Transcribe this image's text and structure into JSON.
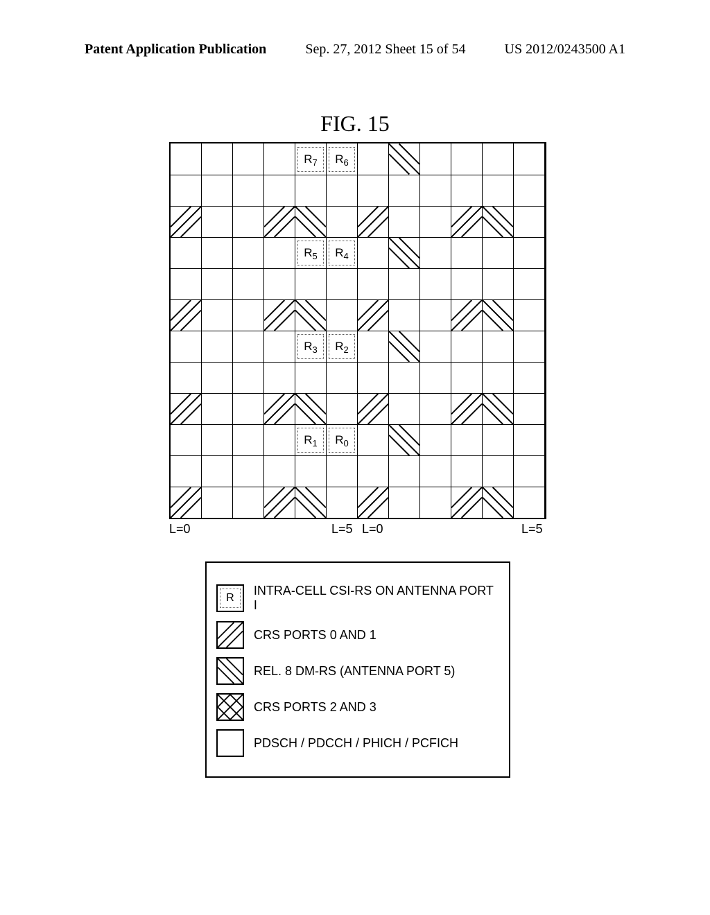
{
  "header": {
    "left": "Patent Application Publication",
    "center": "Sep. 27, 2012  Sheet 15 of 54",
    "right": "US 2012/0243500 A1"
  },
  "figure_title": "FIG. 15",
  "chart_data": {
    "type": "table",
    "rows": 12,
    "cols": 12,
    "xlabel_left_slot": "L=0",
    "xlabel_mid_left": "L=5",
    "xlabel_mid_right": "L=0",
    "xlabel_right_slot": "L=5",
    "r_cells": [
      {
        "row": 0,
        "col": 4,
        "label_prefix": "R",
        "label_sub": "7"
      },
      {
        "row": 0,
        "col": 5,
        "label_prefix": "R",
        "label_sub": "6"
      },
      {
        "row": 3,
        "col": 4,
        "label_prefix": "R",
        "label_sub": "5"
      },
      {
        "row": 3,
        "col": 5,
        "label_prefix": "R",
        "label_sub": "4"
      },
      {
        "row": 6,
        "col": 4,
        "label_prefix": "R",
        "label_sub": "3"
      },
      {
        "row": 6,
        "col": 5,
        "label_prefix": "R",
        "label_sub": "2"
      },
      {
        "row": 9,
        "col": 4,
        "label_prefix": "R",
        "label_sub": "1"
      },
      {
        "row": 9,
        "col": 5,
        "label_prefix": "R",
        "label_sub": "0"
      }
    ],
    "diag_forward_cells": [
      [
        2,
        0
      ],
      [
        2,
        3
      ],
      [
        2,
        6
      ],
      [
        2,
        9
      ],
      [
        5,
        0
      ],
      [
        5,
        3
      ],
      [
        5,
        6
      ],
      [
        5,
        9
      ],
      [
        8,
        0
      ],
      [
        8,
        3
      ],
      [
        8,
        6
      ],
      [
        8,
        9
      ],
      [
        11,
        0
      ],
      [
        11,
        3
      ],
      [
        11,
        6
      ],
      [
        11,
        9
      ]
    ],
    "diag_back_cells": [
      [
        0,
        7
      ],
      [
        3,
        7
      ],
      [
        6,
        7
      ],
      [
        9,
        7
      ],
      [
        2,
        4
      ],
      [
        2,
        10
      ],
      [
        5,
        4
      ],
      [
        5,
        10
      ],
      [
        8,
        4
      ],
      [
        8,
        10
      ],
      [
        11,
        4
      ],
      [
        11,
        10
      ]
    ]
  },
  "legend": {
    "items": {
      "r": "INTRA-CELL CSI-RS ON ANTENNA PORT I",
      "crs01": "CRS PORTS 0 AND 1",
      "dmrs": "REL. 8 DM-RS (ANTENNA PORT 5)",
      "crs23": "CRS PORTS 2 AND 3",
      "pdsch": "PDSCH / PDCCH / PHICH / PCFICH"
    },
    "r_symbol": "R"
  }
}
